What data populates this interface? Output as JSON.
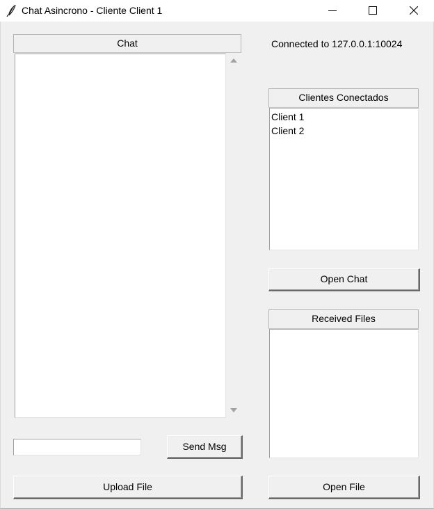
{
  "window": {
    "title": "Chat Asincrono - Cliente Client 1",
    "icon": "feather-icon",
    "controls": [
      "minimize-icon",
      "maximize-icon",
      "close-icon"
    ]
  },
  "chat": {
    "header": "Chat",
    "messages": [],
    "input_value": "",
    "send_label": "Send Msg",
    "upload_label": "Upload File"
  },
  "status": {
    "text": "Connected to 127.0.0.1:10024"
  },
  "clients": {
    "header": "Clientes Conectados",
    "items": [
      {
        "name": "Client 1"
      },
      {
        "name": "Client 2"
      }
    ],
    "open_chat_label": "Open Chat"
  },
  "files": {
    "header": "Received Files",
    "items": [],
    "open_file_label": "Open File"
  }
}
